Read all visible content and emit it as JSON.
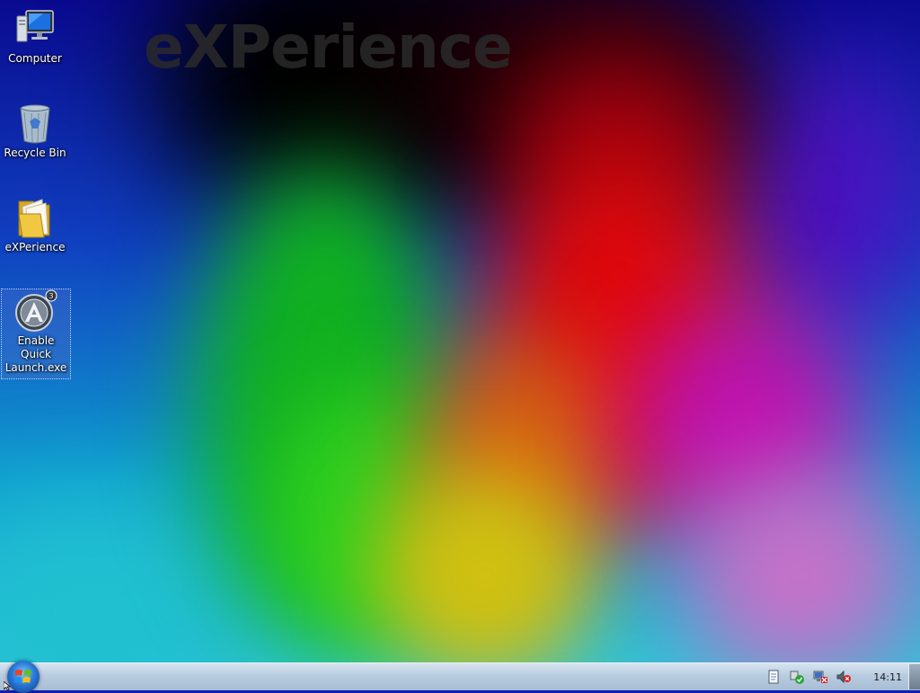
{
  "desktop": {
    "watermark": "eXPerience",
    "icons": [
      {
        "label": "Computer",
        "icon": "computer-icon"
      },
      {
        "label": "Recycle Bin",
        "icon": "recycle-bin-icon"
      },
      {
        "label": "eXPerience",
        "icon": "folder-icon"
      },
      {
        "label": "Enable Quick Launch.exe",
        "icon": "app-icon",
        "selected": true
      }
    ]
  },
  "taskbar": {
    "start_icon": "windows-start-orb-icon",
    "tray_icons": [
      "document-icon",
      "security-check-icon",
      "network-disconnected-icon",
      "volume-muted-icon"
    ],
    "clock": "14:11"
  },
  "colors": {
    "taskbar_top": "#d8e4f0",
    "taskbar_bottom": "#a8bdd4",
    "icon_label": "#ffffff"
  }
}
